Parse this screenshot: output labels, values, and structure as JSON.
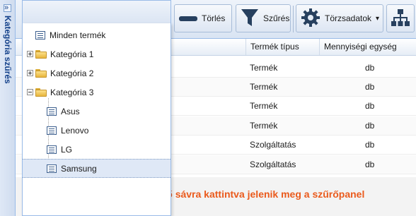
{
  "sidebar": {
    "title": "Kategória szűrés",
    "expand_glyph": "»"
  },
  "toolbar": {
    "delete_label": "Törlés",
    "filter_label": "Szűrés",
    "master_data_label": "Törzsadatok",
    "dropdown_glyph": "▾"
  },
  "grid": {
    "columns": [
      "Termék típus",
      "Mennyiségi egység"
    ],
    "rows": [
      {
        "type": "Termék",
        "unit": "db"
      },
      {
        "type": "Termék",
        "unit": "db"
      },
      {
        "type": "Termék",
        "unit": "db"
      },
      {
        "type": "Termék",
        "unit": "db"
      },
      {
        "type": "Szolgáltatás",
        "unit": "db"
      },
      {
        "type": "Szolgáltatás",
        "unit": "db"
      }
    ]
  },
  "tree": {
    "nodes": [
      {
        "label": "Minden termék",
        "kind": "leaf"
      },
      {
        "label": "Kategória 1",
        "kind": "folder-collapsed"
      },
      {
        "label": "Kategória 2",
        "kind": "folder-collapsed"
      },
      {
        "label": "Kategória 3",
        "kind": "folder-expanded"
      },
      {
        "label": "Asus",
        "kind": "leaf"
      },
      {
        "label": "Lenovo",
        "kind": "leaf"
      },
      {
        "label": "LG",
        "kind": "leaf"
      },
      {
        "label": "Samsung",
        "kind": "leaf",
        "selected": true
      }
    ]
  },
  "hint": "Kategória szűrő sávra kattintva jelenik  meg a szűrőpanel",
  "colors": {
    "hint": "#ea5a1c",
    "accent": "#15428b",
    "border": "#99bbe8"
  }
}
